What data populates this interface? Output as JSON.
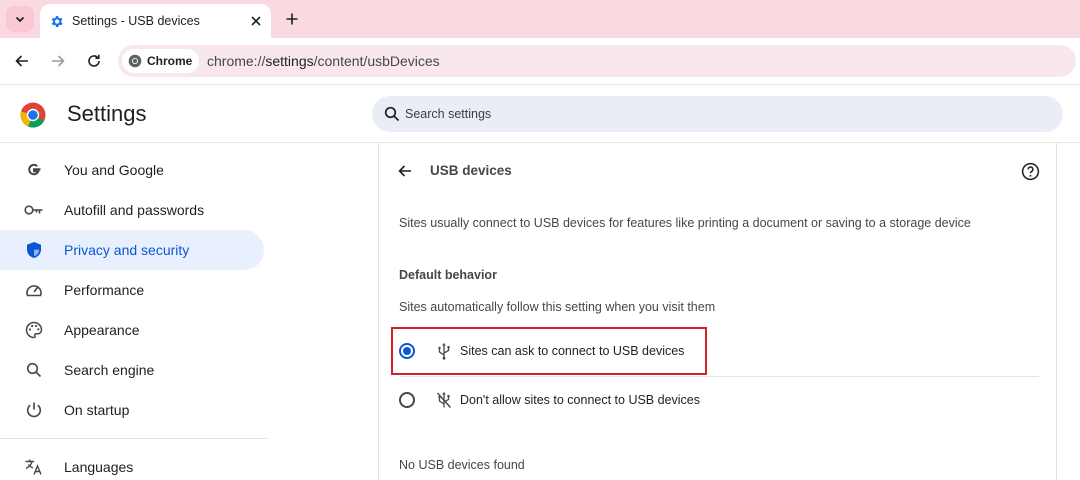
{
  "tab": {
    "title": "Settings - USB devices"
  },
  "toolbar": {
    "chip_label": "Chrome",
    "url_scheme": "chrome://",
    "url_host": "settings",
    "url_path": "/content/usbDevices"
  },
  "header": {
    "title": "Settings",
    "search_placeholder": "Search settings"
  },
  "sidebar": {
    "items": [
      {
        "label": "You and Google",
        "icon": "google-g-icon"
      },
      {
        "label": "Autofill and passwords",
        "icon": "key-icon"
      },
      {
        "label": "Privacy and security",
        "icon": "shield-icon",
        "active": true
      },
      {
        "label": "Performance",
        "icon": "speedometer-icon"
      },
      {
        "label": "Appearance",
        "icon": "palette-icon"
      },
      {
        "label": "Search engine",
        "icon": "search-icon"
      },
      {
        "label": "On startup",
        "icon": "power-icon"
      },
      {
        "label": "Languages",
        "icon": "translate-icon"
      }
    ]
  },
  "page": {
    "title": "USB devices",
    "description": "Sites usually connect to USB devices for features like printing a document or saving to a storage device",
    "default_behavior": {
      "heading": "Default behavior",
      "subheading": "Sites automatically follow this setting when you visit them",
      "options": [
        {
          "label": "Sites can ask to connect to USB devices",
          "icon": "usb-icon",
          "selected": true
        },
        {
          "label": "Don't allow sites to connect to USB devices",
          "icon": "usb-off-icon",
          "selected": false
        }
      ]
    },
    "empty_message": "No USB devices found"
  },
  "colors": {
    "tabstrip": "#fbd9e1",
    "accent": "#0b57d0",
    "active_nav_bg": "#e8f0fe",
    "highlight_box": "#d5212b"
  }
}
